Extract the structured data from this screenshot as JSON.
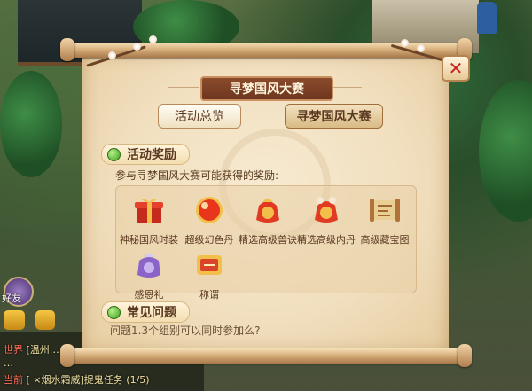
{
  "dialog": {
    "title": "寻梦国风大赛",
    "close_icon": "close-icon",
    "tabs": [
      {
        "label": "活动总览",
        "selected": false
      },
      {
        "label": "寻梦国风大赛",
        "selected": true
      }
    ],
    "rewards_section": {
      "heading": "活动奖励",
      "description": "参与寻梦国风大赛可能获得的奖励:",
      "items": [
        {
          "label": "神秘国风时装",
          "icon": "gift-box-icon"
        },
        {
          "label": "超级幻色丹",
          "icon": "orb-icon"
        },
        {
          "label": "精选高级兽诀",
          "icon": "lucky-bag-icon"
        },
        {
          "label": "精选高级内丹",
          "icon": "lucky-bag-icon"
        },
        {
          "label": "高级藏宝图",
          "icon": "treasure-map-icon"
        },
        {
          "label": "感恩礼",
          "icon": "gift-pouch-icon"
        },
        {
          "label": "称谓",
          "icon": "title-plaque-icon"
        }
      ]
    },
    "faq_section": {
      "heading": "常见问题",
      "question": "问题1.3个组别可以同时参加么?"
    }
  },
  "hud": {
    "friend_label": "好友",
    "chat_lines": [
      {
        "tag": "世界",
        "text": "[温州…"
      },
      {
        "tag": "",
        "text": "…"
      },
      {
        "tag": "当前",
        "text": "[ ×烟水霜威]捉鬼任务 (1/5)"
      }
    ]
  },
  "colors": {
    "title_bg": "#7a3f25",
    "close_x": "#c9211b",
    "section_dot": "#3d9a1d",
    "text": "#5b3820"
  }
}
